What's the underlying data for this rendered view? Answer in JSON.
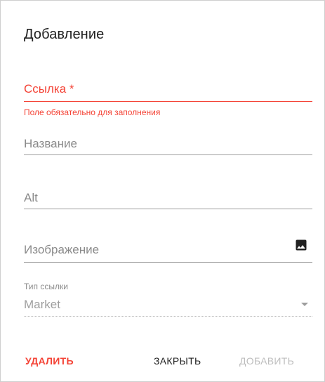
{
  "dialog": {
    "title": "Добавление",
    "fields": {
      "link": {
        "label": "Ссылка *",
        "error": "Поле обязательно для заполнения"
      },
      "name": {
        "label": "Название"
      },
      "alt": {
        "label": "Alt"
      },
      "image": {
        "label": "Изображение",
        "icon": "image-icon"
      }
    },
    "link_type": {
      "label": "Тип ссылки",
      "value": "Market",
      "icon": "dropdown-arrow-icon"
    },
    "buttons": {
      "delete": "УДАЛИТЬ",
      "close": "ЗАКРЫТЬ",
      "add": "ДОБАВИТЬ"
    }
  },
  "colors": {
    "error": "#f44336",
    "text": "#212121",
    "hint": "#8a8a8a",
    "disabled": "#bdbdbd"
  }
}
